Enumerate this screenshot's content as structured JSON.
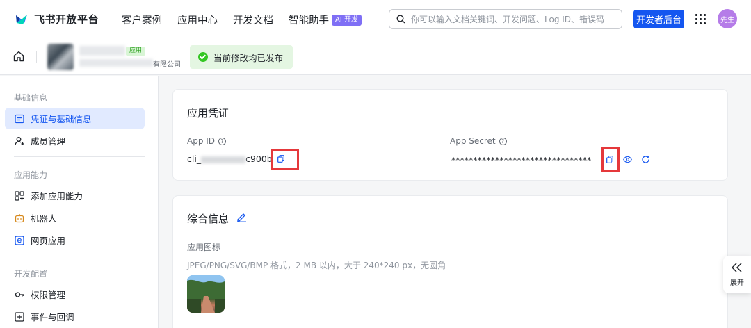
{
  "header": {
    "logo_text": "飞书开放平台",
    "nav": [
      "客户案例",
      "应用中心",
      "开发文档",
      "智能助手"
    ],
    "ai_badge": "AI 开发",
    "search_placeholder": "你可以输入文档关键词、开发问题、Log ID、错误码",
    "dev_console_label": "开发者后台",
    "avatar_text": "先生",
    "brand_color": "#1456f0"
  },
  "subheader": {
    "app_tag": "应用",
    "company_suffix": "有限公司",
    "publish_status": "当前修改均已发布"
  },
  "sidebar": {
    "groups": [
      {
        "title": "基础信息",
        "items": [
          {
            "label": "凭证与基础信息",
            "icon": "credential-icon",
            "active": true
          },
          {
            "label": "成员管理",
            "icon": "member-icon",
            "active": false
          }
        ]
      },
      {
        "title": "应用能力",
        "items": [
          {
            "label": "添加应用能力",
            "icon": "add-capability-icon",
            "active": false
          },
          {
            "label": "机器人",
            "icon": "robot-icon",
            "active": false
          },
          {
            "label": "网页应用",
            "icon": "web-app-icon",
            "active": false
          }
        ]
      },
      {
        "title": "开发配置",
        "items": [
          {
            "label": "权限管理",
            "icon": "permission-icon",
            "active": false
          },
          {
            "label": "事件与回调",
            "icon": "event-icon",
            "active": false
          }
        ]
      }
    ]
  },
  "credentials": {
    "title": "应用凭证",
    "app_id_label": "App ID",
    "app_id_prefix": "cli_",
    "app_id_suffix": "c900b",
    "app_secret_label": "App Secret",
    "app_secret_masked": "********************************"
  },
  "general_info": {
    "title": "综合信息",
    "app_icon_label": "应用图标",
    "app_icon_hint": "JPEG/PNG/SVG/BMP 格式，2 MB 以内，大于 240*240 px，无圆角"
  },
  "expand_panel": {
    "label": "展开"
  }
}
